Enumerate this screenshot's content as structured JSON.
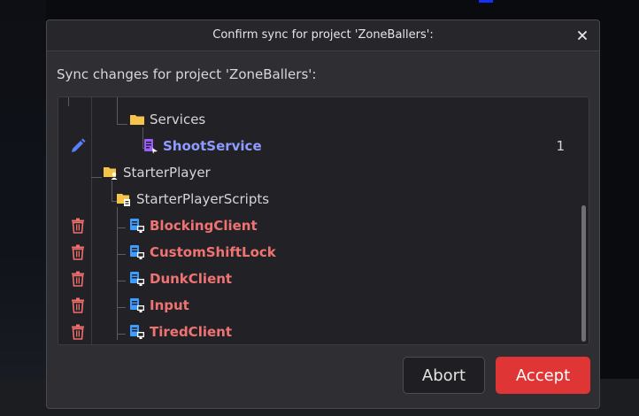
{
  "dialog": {
    "title": "Confirm sync for project 'ZoneBallers':",
    "subtitle": "Sync changes for project 'ZoneBallers':"
  },
  "tree": {
    "rows": [
      {
        "label": "Services",
        "icon": "folder-icon",
        "state": "none",
        "status_icon": "",
        "count": ""
      },
      {
        "label": "ShootService",
        "icon": "module-script-icon",
        "state": "modified",
        "status_icon": "pencil-icon",
        "count": "1"
      },
      {
        "label": "StarterPlayer",
        "icon": "starter-player-icon",
        "state": "none",
        "status_icon": "",
        "count": ""
      },
      {
        "label": "StarterPlayerScripts",
        "icon": "starter-player-scripts-icon",
        "state": "none",
        "status_icon": "",
        "count": ""
      },
      {
        "label": "BlockingClient",
        "icon": "local-script-icon",
        "state": "deleted",
        "status_icon": "trash-icon",
        "count": ""
      },
      {
        "label": "CustomShiftLock",
        "icon": "local-script-icon",
        "state": "deleted",
        "status_icon": "trash-icon",
        "count": ""
      },
      {
        "label": "DunkClient",
        "icon": "local-script-icon",
        "state": "deleted",
        "status_icon": "trash-icon",
        "count": ""
      },
      {
        "label": "Input",
        "icon": "local-script-icon",
        "state": "deleted",
        "status_icon": "trash-icon",
        "count": ""
      },
      {
        "label": "TiredClient",
        "icon": "local-script-icon",
        "state": "deleted",
        "status_icon": "trash-icon",
        "count": ""
      }
    ]
  },
  "buttons": {
    "abort": "Abort",
    "accept": "Accept"
  },
  "colors": {
    "accept": "#e03535",
    "deleted_text": "#f07373",
    "modified_text": "#8e9bff",
    "folder": "#f5c44a",
    "script_icon": "#3e9bff",
    "module_icon": "#9a5cff",
    "trash": "#ee6d6d",
    "pencil": "#5b7eff"
  }
}
